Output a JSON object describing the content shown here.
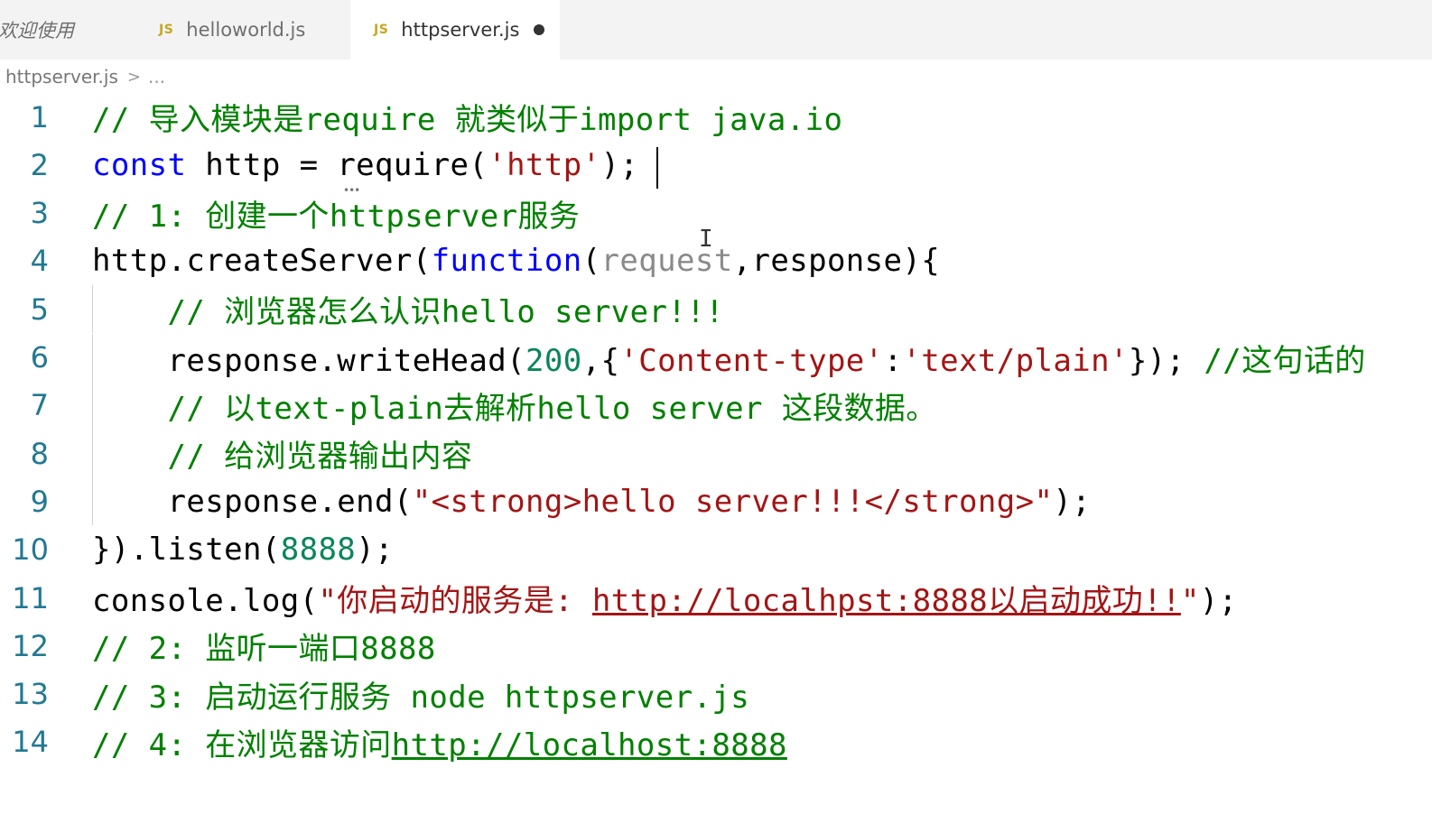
{
  "tabs": [
    {
      "label": "欢迎使用",
      "active": false,
      "icon": "none"
    },
    {
      "label": "helloworld.js",
      "active": false,
      "icon": "js-icon",
      "icon_text": "JS"
    },
    {
      "label": "httpserver.js",
      "active": true,
      "icon": "js-icon",
      "icon_text": "JS",
      "dirty": true
    }
  ],
  "breadcrumb": {
    "file": "httpserver.js",
    "separator": ">",
    "more": "..."
  },
  "colors": {
    "comment": "#008000",
    "keyword": "#0000ff",
    "string": "#a31515",
    "number": "#098658",
    "line_number": "#237893"
  },
  "lines": [
    {
      "n": "1",
      "tokens": [
        [
          "c-com",
          "// 导入模块是require 就类似于import java.io"
        ]
      ]
    },
    {
      "n": "2",
      "tokens": [
        [
          "c-kw",
          "const"
        ],
        [
          "",
          " http = require("
        ],
        [
          "c-str",
          "'http'"
        ],
        [
          "",
          ");"
        ]
      ]
    },
    {
      "n": "3",
      "tokens": [
        [
          "c-com",
          "// 1: 创建一个httpserver服务"
        ]
      ]
    },
    {
      "n": "4",
      "tokens": [
        [
          "",
          "http.createServer("
        ],
        [
          "c-kw",
          "function"
        ],
        [
          "",
          "("
        ],
        [
          "c-dim",
          "request"
        ],
        [
          "",
          ",response){"
        ]
      ]
    },
    {
      "n": "5",
      "tokens": [
        [
          "",
          "    "
        ],
        [
          "c-com",
          "// 浏览器怎么认识hello server!!!"
        ]
      ]
    },
    {
      "n": "6",
      "tokens": [
        [
          "",
          "    response.writeHead("
        ],
        [
          "c-num",
          "200"
        ],
        [
          "",
          ",{"
        ],
        [
          "c-str",
          "'Content-type'"
        ],
        [
          "",
          ":"
        ],
        [
          "c-str",
          "'text/plain'"
        ],
        [
          "",
          "}); "
        ],
        [
          "c-com",
          "//这句话的"
        ]
      ]
    },
    {
      "n": "7",
      "tokens": [
        [
          "",
          "    "
        ],
        [
          "c-com",
          "// 以text-plain去解析hello server 这段数据。"
        ]
      ]
    },
    {
      "n": "8",
      "tokens": [
        [
          "",
          "    "
        ],
        [
          "c-com",
          "// 给浏览器输出内容"
        ]
      ]
    },
    {
      "n": "9",
      "tokens": [
        [
          "",
          "    response.end("
        ],
        [
          "c-str",
          "\"<strong>hello server!!!</strong>\""
        ],
        [
          "",
          ");"
        ]
      ]
    },
    {
      "n": "10",
      "tokens": [
        [
          "",
          "}).listen("
        ],
        [
          "c-num",
          "8888"
        ],
        [
          "",
          ");"
        ]
      ]
    },
    {
      "n": "11",
      "tokens": [
        [
          "",
          "console.log("
        ],
        [
          "c-str",
          "\"你启动的服务是: "
        ],
        [
          "c-str u-red",
          "http://localhpst:8888以启动成功!!"
        ],
        [
          "c-str",
          "\""
        ],
        [
          "",
          ");"
        ]
      ]
    },
    {
      "n": "12",
      "tokens": [
        [
          "c-com",
          "// 2: 监听一端口8888"
        ]
      ]
    },
    {
      "n": "13",
      "tokens": [
        [
          "c-com",
          "// 3: 启动运行服务 node httpserver.js"
        ]
      ]
    },
    {
      "n": "14",
      "tokens": [
        [
          "c-com",
          "// 4: 在浏览器访问"
        ],
        [
          "c-com u-green",
          "http://localhost:8888"
        ]
      ]
    }
  ]
}
